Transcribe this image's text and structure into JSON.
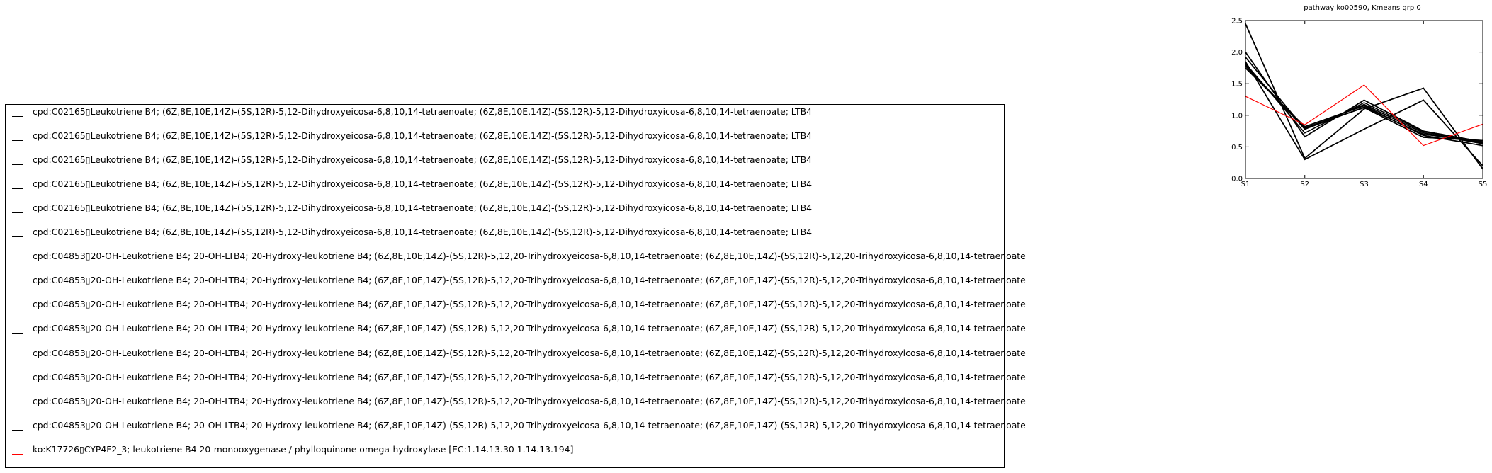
{
  "chart_data": {
    "type": "line",
    "title": "pathway ko00590, Kmeans grp 0",
    "xlabel": "",
    "ylabel": "",
    "x": [
      "S1",
      "S2",
      "S3",
      "S4",
      "S5"
    ],
    "ylim": [
      0.0,
      2.5
    ],
    "yticks": [
      "0.0",
      "0.5",
      "1.0",
      "1.5",
      "2.0",
      "2.5"
    ],
    "grid": false,
    "legend_placement": "separate box left of plot",
    "colors": {
      "series": "#000000",
      "highlight": "#ff0000"
    },
    "series": [
      {
        "name": "cpd:C02165▯Leukotriene B4; (6Z,8E,10E,14Z)-(5S,12R)-5,12-Dihydroxyeicosa-6,8,10,14-tetraenoate; (6Z,8E,10E,14Z)-(5S,12R)-5,12-Dihydroxyicosa-6,8,10,14-tetraenoate; LTB4",
        "color": "#000000",
        "values": [
          2.45,
          0.32,
          1.1,
          1.43,
          0.15
        ]
      },
      {
        "name": "cpd:C02165▯Leukotriene B4; (6Z,8E,10E,14Z)-(5S,12R)-5,12-Dihydroxyeicosa-6,8,10,14-tetraenoate; (6Z,8E,10E,14Z)-(5S,12R)-5,12-Dihydroxyicosa-6,8,10,14-tetraenoate; LTB4",
        "color": "#000000",
        "values": [
          2.0,
          0.66,
          1.24,
          0.75,
          0.58
        ]
      },
      {
        "name": "cpd:C02165▯Leukotriene B4; (6Z,8E,10E,14Z)-(5S,12R)-5,12-Dihydroxyeicosa-6,8,10,14-tetraenoate; (6Z,8E,10E,14Z)-(5S,12R)-5,12-Dihydroxyicosa-6,8,10,14-tetraenoate; LTB4",
        "color": "#000000",
        "values": [
          1.92,
          0.78,
          1.17,
          0.72,
          0.55
        ]
      },
      {
        "name": "cpd:C02165▯Leukotriene B4; (6Z,8E,10E,14Z)-(5S,12R)-5,12-Dihydroxyeicosa-6,8,10,14-tetraenoate; (6Z,8E,10E,14Z)-(5S,12R)-5,12-Dihydroxyicosa-6,8,10,14-tetraenoate; LTB4",
        "color": "#000000",
        "values": [
          1.85,
          0.3,
          0.78,
          1.24,
          0.2
        ]
      },
      {
        "name": "cpd:C02165▯Leukotriene B4; (6Z,8E,10E,14Z)-(5S,12R)-5,12-Dihydroxyeicosa-6,8,10,14-tetraenoate; (6Z,8E,10E,14Z)-(5S,12R)-5,12-Dihydroxyicosa-6,8,10,14-tetraenoate; LTB4",
        "color": "#000000",
        "values": [
          1.78,
          0.8,
          1.12,
          0.65,
          0.6
        ]
      },
      {
        "name": "cpd:C02165▯Leukotriene B4; (6Z,8E,10E,14Z)-(5S,12R)-5,12-Dihydroxyeicosa-6,8,10,14-tetraenoate; (6Z,8E,10E,14Z)-(5S,12R)-5,12-Dihydroxyicosa-6,8,10,14-tetraenoate; LTB4",
        "color": "#000000",
        "values": [
          1.75,
          0.82,
          1.15,
          0.68,
          0.52
        ]
      },
      {
        "name": "cpd:C04853▯20-OH-Leukotriene B4; 20-OH-LTB4; 20-Hydroxy-leukotriene B4; (6Z,8E,10E,14Z)-(5S,12R)-5,12,20-Trihydroxyeicosa-6,8,10,14-tetraenoate; (6Z,8E,10E,14Z)-(5S,12R)-5,12,20-Trihydroxyicosa-6,8,10,14-tetraenoate",
        "color": "#000000",
        "values": [
          2.45,
          0.32,
          1.1,
          1.43,
          0.15
        ]
      },
      {
        "name": "cpd:C04853▯20-OH-Leukotriene B4; 20-OH-LTB4; 20-Hydroxy-leukotriene B4; (6Z,8E,10E,14Z)-(5S,12R)-5,12,20-Trihydroxyeicosa-6,8,10,14-tetraenoate; (6Z,8E,10E,14Z)-(5S,12R)-5,12,20-Trihydroxyicosa-6,8,10,14-tetraenoate",
        "color": "#000000",
        "values": [
          2.0,
          0.66,
          1.24,
          0.75,
          0.58
        ]
      },
      {
        "name": "cpd:C04853▯20-OH-Leukotriene B4; 20-OH-LTB4; 20-Hydroxy-leukotriene B4; (6Z,8E,10E,14Z)-(5S,12R)-5,12,20-Trihydroxyeicosa-6,8,10,14-tetraenoate; (6Z,8E,10E,14Z)-(5S,12R)-5,12,20-Trihydroxyicosa-6,8,10,14-tetraenoate",
        "color": "#000000",
        "values": [
          1.92,
          0.78,
          1.17,
          0.72,
          0.55
        ]
      },
      {
        "name": "cpd:C04853▯20-OH-Leukotriene B4; 20-OH-LTB4; 20-Hydroxy-leukotriene B4; (6Z,8E,10E,14Z)-(5S,12R)-5,12,20-Trihydroxyeicosa-6,8,10,14-tetraenoate; (6Z,8E,10E,14Z)-(5S,12R)-5,12,20-Trihydroxyicosa-6,8,10,14-tetraenoate",
        "color": "#000000",
        "values": [
          1.85,
          0.3,
          0.78,
          1.24,
          0.2
        ]
      },
      {
        "name": "cpd:C04853▯20-OH-Leukotriene B4; 20-OH-LTB4; 20-Hydroxy-leukotriene B4; (6Z,8E,10E,14Z)-(5S,12R)-5,12,20-Trihydroxyeicosa-6,8,10,14-tetraenoate; (6Z,8E,10E,14Z)-(5S,12R)-5,12,20-Trihydroxyicosa-6,8,10,14-tetraenoate",
        "color": "#000000",
        "values": [
          1.78,
          0.8,
          1.12,
          0.65,
          0.6
        ]
      },
      {
        "name": "cpd:C04853▯20-OH-Leukotriene B4; 20-OH-LTB4; 20-Hydroxy-leukotriene B4; (6Z,8E,10E,14Z)-(5S,12R)-5,12,20-Trihydroxyeicosa-6,8,10,14-tetraenoate; (6Z,8E,10E,14Z)-(5S,12R)-5,12,20-Trihydroxyicosa-6,8,10,14-tetraenoate",
        "color": "#000000",
        "values": [
          1.75,
          0.82,
          1.15,
          0.68,
          0.52
        ]
      },
      {
        "name": "cpd:C04853▯20-OH-Leukotriene B4; 20-OH-LTB4; 20-Hydroxy-leukotriene B4; (6Z,8E,10E,14Z)-(5S,12R)-5,12,20-Trihydroxyeicosa-6,8,10,14-tetraenoate; (6Z,8E,10E,14Z)-(5S,12R)-5,12,20-Trihydroxyicosa-6,8,10,14-tetraenoate",
        "color": "#000000",
        "values": [
          1.8,
          0.78,
          1.13,
          0.7,
          0.57
        ]
      },
      {
        "name": "cpd:C04853▯20-OH-Leukotriene B4; 20-OH-LTB4; 20-Hydroxy-leukotriene B4; (6Z,8E,10E,14Z)-(5S,12R)-5,12,20-Trihydroxyeicosa-6,8,10,14-tetraenoate; (6Z,8E,10E,14Z)-(5S,12R)-5,12,20-Trihydroxyicosa-6,8,10,14-tetraenoate",
        "color": "#000000",
        "values": [
          1.82,
          0.72,
          1.2,
          0.74,
          0.56
        ]
      },
      {
        "name": "ko:K17726▯CYP4F2_3; leukotriene-B4 20-monooxygenase / phylloquinone omega-hydroxylase [EC:1.14.13.30 1.14.13.194]",
        "color": "#ff0000",
        "values": [
          1.3,
          0.85,
          1.48,
          0.52,
          0.86
        ]
      }
    ]
  }
}
